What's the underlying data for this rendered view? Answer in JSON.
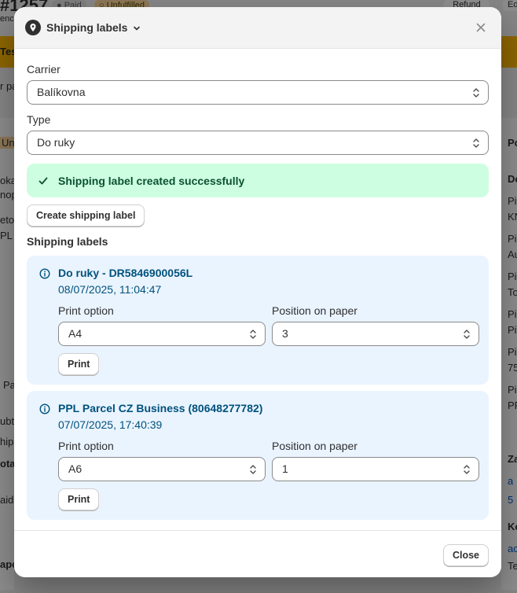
{
  "background": {
    "order_number": "#1257",
    "paid_badge": "● Paid",
    "unfulfilled_badge": "○ Unfulfilled",
    "refund_button": "Refund",
    "edit_button": "Ed",
    "left_texts": [
      "enc",
      "Tes",
      "r pa",
      "Un",
      "oka",
      "nop",
      "eto",
      "PL I",
      "Pa",
      "ubto",
      "hipp",
      "otal",
      "aid",
      "apo"
    ],
    "right_texts": [
      "Po",
      "Do",
      "Pi",
      "KN",
      "Pi",
      "Au",
      "Pi",
      "To",
      "Pi",
      "Pi",
      "Pi",
      "75",
      "Pi",
      "PF",
      "Za",
      "a",
      "5",
      "Ko",
      "ac",
      "Te"
    ]
  },
  "header": {
    "title": "Shipping labels",
    "close_label": "Close dialog"
  },
  "form": {
    "carrier": {
      "label": "Carrier",
      "value": "Balíkovna"
    },
    "type": {
      "label": "Type",
      "value": "Do ruky"
    }
  },
  "success_banner": {
    "text": "Shipping label created successfully"
  },
  "create_button": "Create shipping label",
  "shipping_labels_title": "Shipping labels",
  "labels": [
    {
      "title": "Do ruky - DR5846900056L",
      "date": "08/07/2025, 11:04:47",
      "print_option_label": "Print option",
      "print_option_value": "A4",
      "position_label": "Position on paper",
      "position_value": "3",
      "print_button": "Print"
    },
    {
      "title": "PPL Parcel CZ Business (80648277782)",
      "date": "07/07/2025, 17:40:39",
      "print_option_label": "Print option",
      "print_option_value": "A6",
      "position_label": "Position on paper",
      "position_value": "1",
      "print_button": "Print"
    }
  ],
  "footer": {
    "close_button": "Close"
  },
  "colors": {
    "success_bg": "#cdfee1",
    "success_text": "#0c5132",
    "info_bg": "#eaf4ff",
    "info_text": "#00527c"
  },
  "icons": {
    "app": "map-pin-icon",
    "chevron": "chevron-down-icon",
    "close": "close-icon",
    "success": "checkmark-icon",
    "info": "info-icon",
    "select": "select-arrows-icon"
  }
}
